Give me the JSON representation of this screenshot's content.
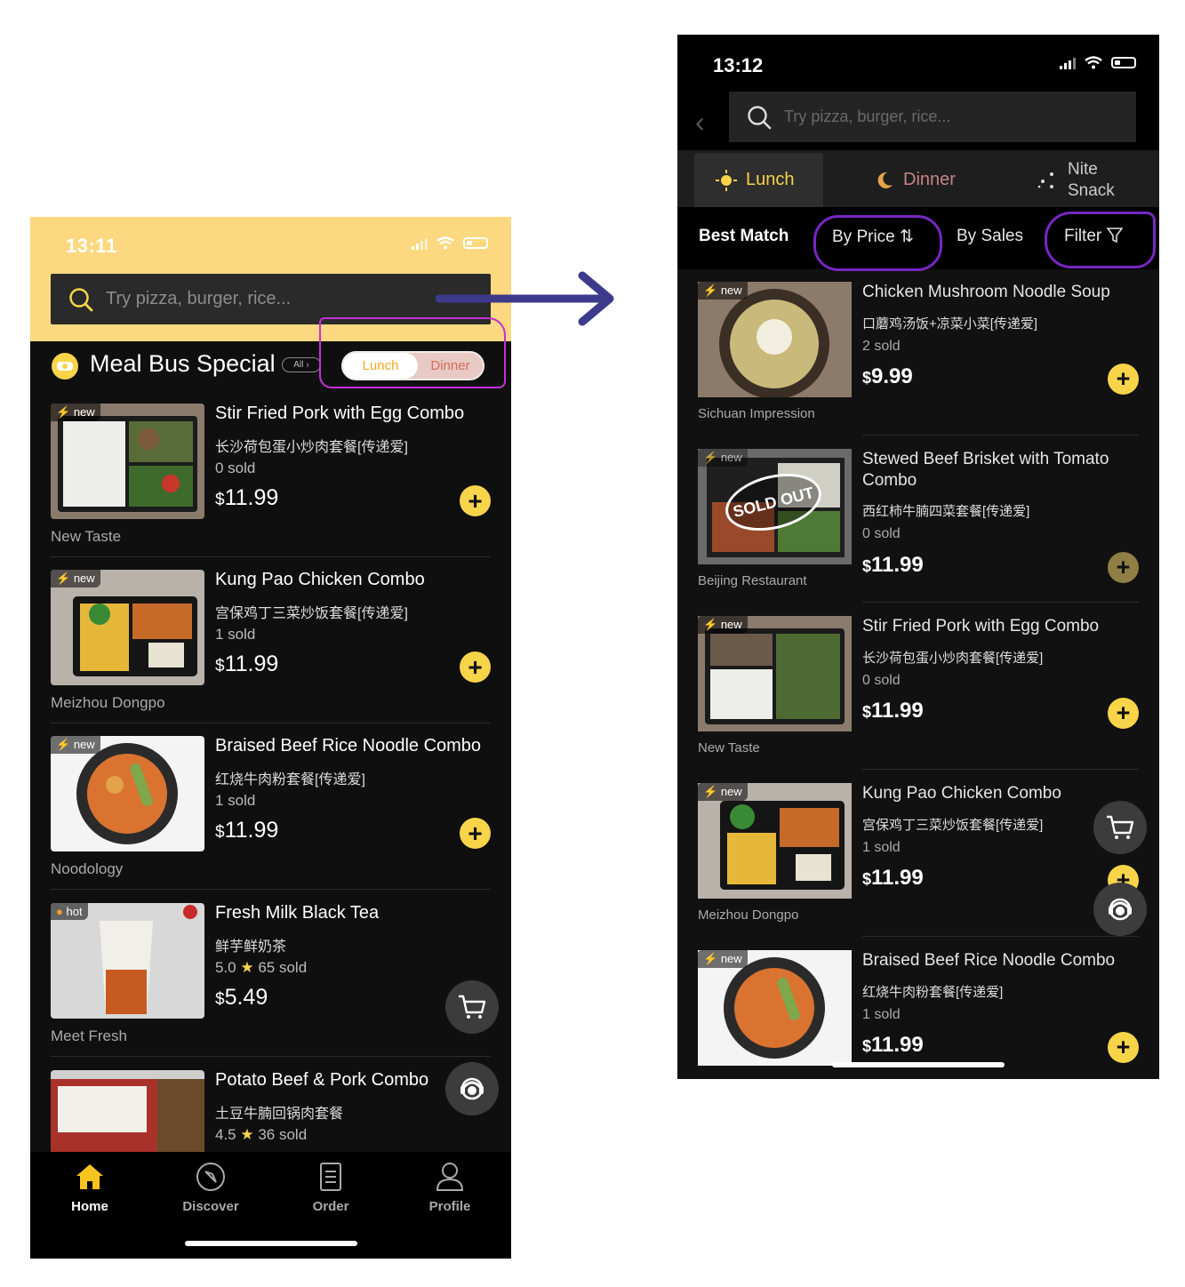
{
  "left": {
    "status": {
      "time": "13:11"
    },
    "search": {
      "placeholder": "Try pizza, burger, rice..."
    },
    "section": {
      "title": "Meal Bus Special",
      "all_label": "All",
      "toggle_on": "Lunch",
      "toggle_off": "Dinner"
    },
    "items": [
      {
        "badge": "new",
        "name": "Stir Fried Pork with Egg Combo",
        "cn": "长沙荷包蛋小炒肉套餐[传递爱]",
        "meta": "0 sold",
        "currency": "$",
        "price": "11.99",
        "shop": "New Taste"
      },
      {
        "badge": "new",
        "name": "Kung Pao Chicken Combo",
        "cn": "宫保鸡丁三菜炒饭套餐[传递爱]",
        "meta": "1 sold",
        "currency": "$",
        "price": "11.99",
        "shop": "Meizhou Dongpo"
      },
      {
        "badge": "new",
        "name": "Braised Beef Rice Noodle Combo",
        "cn": "红烧牛肉粉套餐[传递爱]",
        "meta": "1 sold",
        "currency": "$",
        "price": "11.99",
        "shop": "Noodology"
      },
      {
        "badge": "hot",
        "name": "Fresh Milk Black Tea",
        "cn": "鲜芋鲜奶茶",
        "rating": "5.0",
        "meta": "65 sold",
        "currency": "$",
        "price": "5.49",
        "shop": "Meet Fresh"
      },
      {
        "badge": "",
        "name": "Potato Beef & Pork Combo",
        "cn": "土豆牛腩回锅肉套餐",
        "rating": "4.5",
        "meta": "36 sold"
      }
    ],
    "tabs": [
      {
        "label": "Home",
        "icon": "home-icon"
      },
      {
        "label": "Discover",
        "icon": "compass-icon"
      },
      {
        "label": "Order",
        "icon": "order-icon"
      },
      {
        "label": "Profile",
        "icon": "profile-icon"
      }
    ]
  },
  "right": {
    "status": {
      "time": "13:12"
    },
    "search": {
      "placeholder": "Try pizza, burger, rice..."
    },
    "meal_tabs": [
      {
        "label": "Lunch",
        "icon": "sun-icon"
      },
      {
        "label": "Dinner",
        "icon": "moon-icon"
      },
      {
        "label_line1": "Nite",
        "label_line2": "Snack",
        "icon": "stars-icon"
      }
    ],
    "sort": {
      "best": "Best Match",
      "price": "By Price",
      "sales": "By Sales",
      "filter": "Filter"
    },
    "items": [
      {
        "badge": "new",
        "name": "Chicken Mushroom Noodle Soup",
        "cn": "口蘑鸡汤饭+凉菜小菜[传递爱]",
        "meta": "2 sold",
        "currency": "$",
        "price": "9.99",
        "shop": "Sichuan Impression"
      },
      {
        "badge": "new",
        "name": "Stewed Beef Brisket with Tomato Combo",
        "cn": "西红柿牛腩四菜套餐[传递爱]",
        "meta": "0 sold",
        "currency": "$",
        "price": "11.99",
        "shop": "Beijing Restaurant",
        "sold_out": "SOLD OUT"
      },
      {
        "badge": "new",
        "name": "Stir Fried Pork with Egg Combo",
        "cn": "长沙荷包蛋小炒肉套餐[传递爱]",
        "meta": "0 sold",
        "currency": "$",
        "price": "11.99",
        "shop": "New Taste"
      },
      {
        "badge": "new",
        "name": "Kung Pao Chicken Combo",
        "cn": "宫保鸡丁三菜炒饭套餐[传递爱]",
        "meta": "1 sold",
        "currency": "$",
        "price": "11.99",
        "shop": "Meizhou Dongpo"
      },
      {
        "badge": "new",
        "name": "Braised Beef Rice Noodle Combo",
        "cn": "红烧牛肉粉套餐[传递爱]",
        "meta": "1 sold",
        "currency": "$",
        "price": "11.99"
      }
    ]
  },
  "colors": {
    "accent": "#f7d44a",
    "header_yellow": "#fcd880",
    "annotation_purple": "#7627c2",
    "arrow_navy": "#3d3a8c"
  }
}
